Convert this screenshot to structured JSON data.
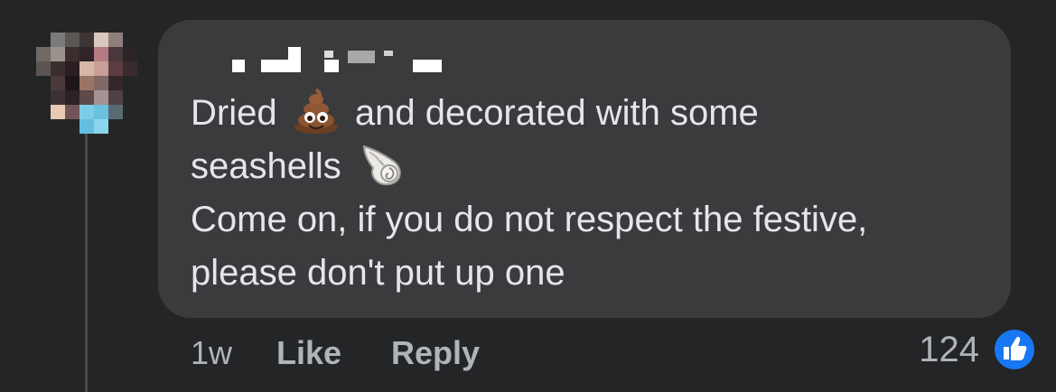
{
  "comment": {
    "text_lines": [
      {
        "before": "Dried",
        "emoji": "poop-emoji",
        "after": "and decorated with some"
      },
      {
        "before": "seashells",
        "emoji": "spiral-shell-emoji",
        "after": ""
      },
      {
        "before": "Come on, if you do not respect the festive,",
        "emoji": "",
        "after": ""
      },
      {
        "before": "please don't put up one",
        "emoji": "",
        "after": ""
      }
    ]
  },
  "meta": {
    "time": "1w",
    "like_label": "Like",
    "reply_label": "Reply"
  },
  "reactions": {
    "count": "124",
    "type": "thumbs-up-icon"
  },
  "colors": {
    "background": "#242526",
    "bubble": "#3a3b3c",
    "text": "#e4e6eb",
    "secondary_text": "#b0b3b8",
    "like_badge": "#1877f2"
  }
}
